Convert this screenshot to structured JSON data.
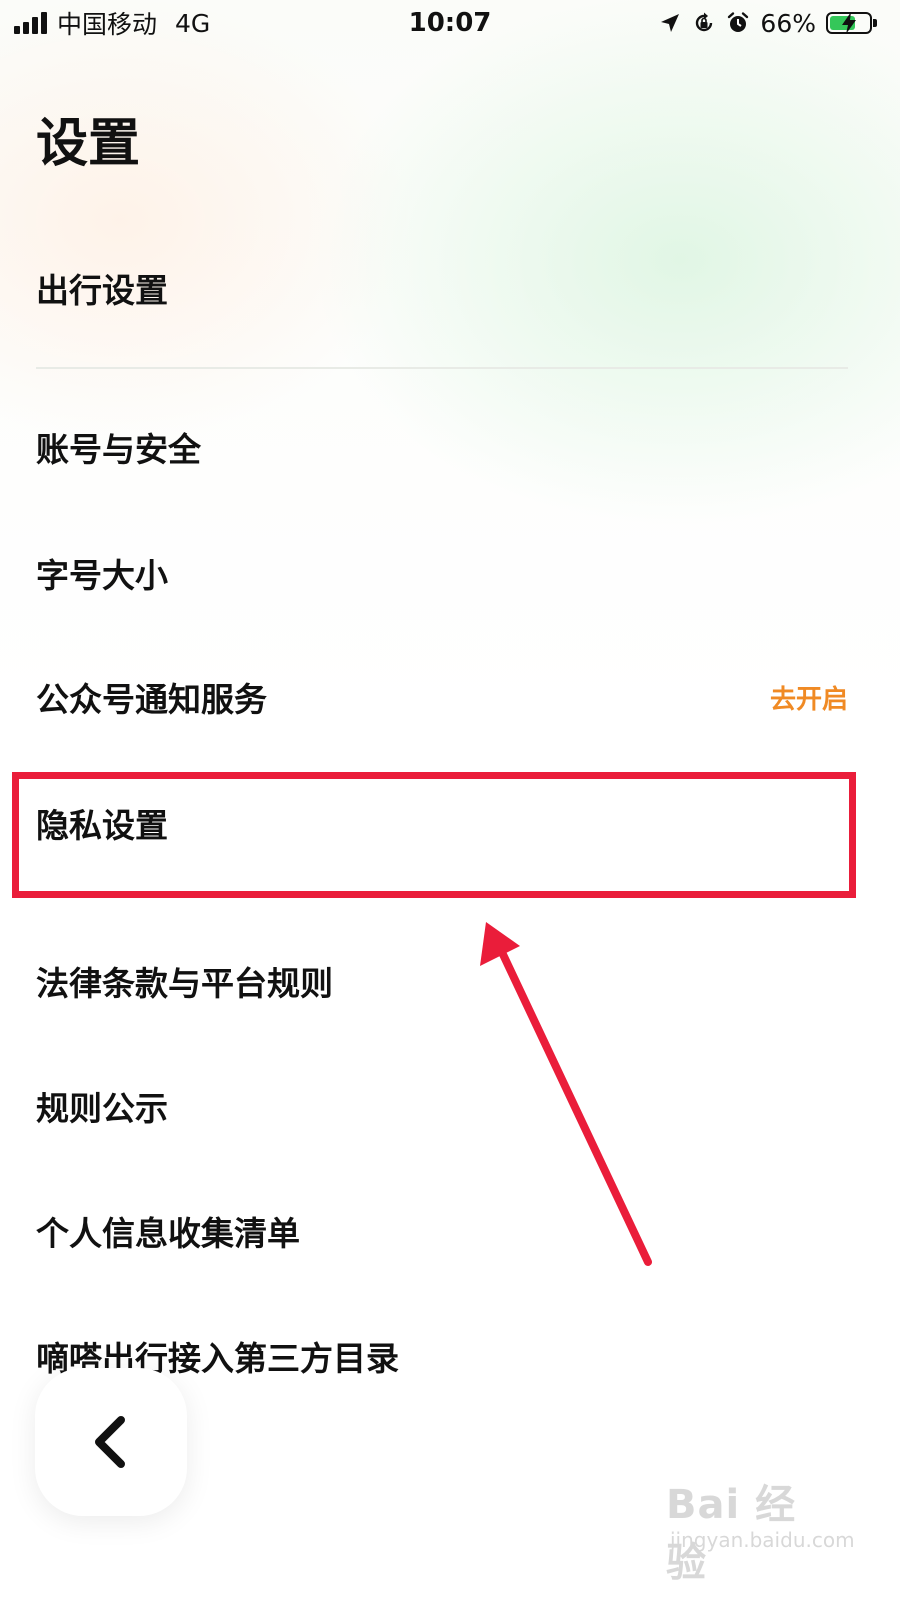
{
  "status_bar": {
    "carrier": "中国移动",
    "network": "4G",
    "time": "10:07",
    "battery_percent_text": "66%",
    "battery_level": 0.66,
    "icons": [
      "signal-icon",
      "location-icon",
      "rotation-lock-icon",
      "alarm-icon",
      "battery-charging-icon"
    ]
  },
  "header": {
    "title": "设置"
  },
  "menu": {
    "items": [
      {
        "label": "出行设置"
      },
      {
        "label": "账号与安全"
      },
      {
        "label": "字号大小"
      },
      {
        "label": "公众号通知服务",
        "action": "去开启"
      },
      {
        "label": "隐私设置"
      },
      {
        "label": "法律条款与平台规则"
      },
      {
        "label": "规则公示"
      },
      {
        "label": "个人信息收集清单"
      },
      {
        "label": "嘀嗒出行接入第三方目录"
      }
    ]
  },
  "back_button": {
    "icon": "chevron-left-icon"
  },
  "watermark": {
    "logo": "Bai 经验",
    "url": "jingyan.baidu.com"
  },
  "colors": {
    "accent_orange": "#f08a24",
    "annotation_red": "#ea1d3a",
    "battery_green": "#34c759"
  }
}
